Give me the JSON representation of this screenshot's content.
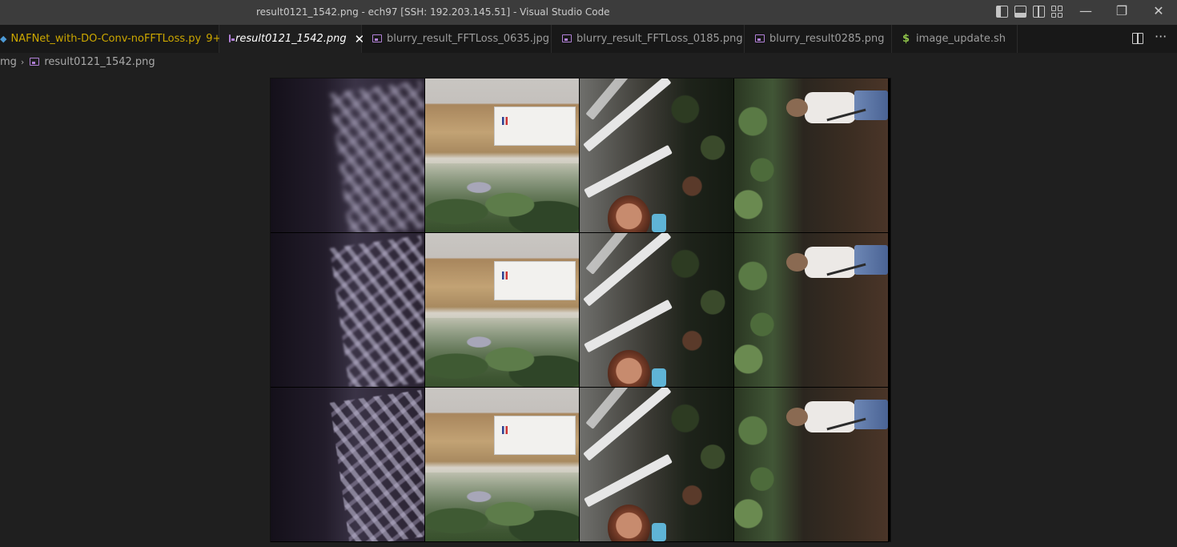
{
  "window": {
    "title": "result0121_1542.png - ech97 [SSH: 192.203.145.51] - Visual Studio Code",
    "controls": {
      "minimize": "—",
      "restore": "❐",
      "close": "✕"
    }
  },
  "tabs": [
    {
      "label": "NAFNet_with-DO-Conv-noFFTLoss.py",
      "badge": "9+",
      "icon": "python-file-icon",
      "modified": true,
      "active": false
    },
    {
      "label": "result0121_1542.png",
      "icon": "image-file-icon",
      "active": true,
      "close": "✕"
    },
    {
      "label": "blurry_result_FFTLoss_0635.jpg",
      "icon": "image-file-icon",
      "active": false
    },
    {
      "label": "blurry_result_FFTLoss_0185.png",
      "icon": "image-file-icon",
      "active": false
    },
    {
      "label": "blurry_result0285.png",
      "icon": "image-file-icon",
      "active": false
    },
    {
      "label": "image_update.sh",
      "icon": "shell-file-icon",
      "sh_glyph": "$",
      "active": false
    }
  ],
  "tab_actions": {
    "more": "···"
  },
  "breadcrumb": {
    "folder": "mg",
    "separator": "›",
    "file": "result0121_1542.png"
  },
  "viewer": {
    "rows": 3,
    "columns": 4,
    "accent_colors": {
      "modified": "#cca700",
      "image_icon": "#b180d7",
      "python_icon": "#4d9ad6",
      "shell_icon": "#8dc149"
    }
  }
}
